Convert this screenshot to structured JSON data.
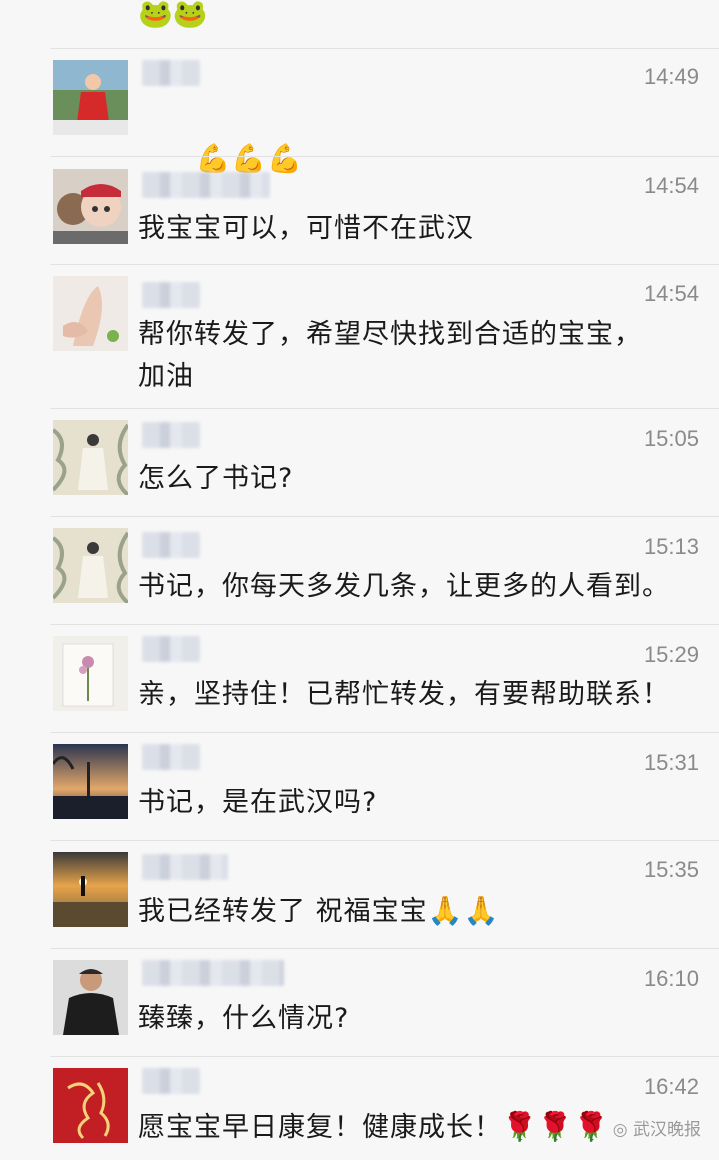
{
  "top_row": {
    "emojis": "🐸🐸"
  },
  "comments": [
    {
      "time": "14:49",
      "message": "",
      "emojis": "💪💪💪",
      "avatar": "avatar-girl-red-dress"
    },
    {
      "time": "14:54",
      "message": "我宝宝可以，可惜不在武汉",
      "emojis": "",
      "avatar": "avatar-baby-headband"
    },
    {
      "time": "14:54",
      "message": "帮你转发了，希望尽快找到合适的宝宝，\n加油",
      "emojis": "",
      "avatar": "avatar-baby-feet"
    },
    {
      "time": "15:05",
      "message": "怎么了书记?",
      "emojis": "",
      "avatar": "avatar-woman-floral"
    },
    {
      "time": "15:13",
      "message": "书记，你每天多发几条，让更多的人看到。",
      "emojis": "",
      "avatar": "avatar-woman-floral"
    },
    {
      "time": "15:29",
      "message": "亲，坚持住！已帮忙转发，有要帮助联系！",
      "emojis": "",
      "avatar": "avatar-flower-painting"
    },
    {
      "time": "15:31",
      "message": "书记，是在武汉吗?",
      "emojis": "",
      "avatar": "avatar-sunset-tower"
    },
    {
      "time": "15:35",
      "message": "我已经转发了 祝福宝宝",
      "emojis": "🙏🙏",
      "avatar": "avatar-beach-silhouette"
    },
    {
      "time": "16:10",
      "message": "臻臻，什么情况?",
      "emojis": "",
      "avatar": "avatar-man-black"
    },
    {
      "time": "16:42",
      "message": "愿宝宝早日康复！健康成长！",
      "emojis": "🌹🌹🌹",
      "avatar": "avatar-red-calligraphy"
    }
  ],
  "watermark": {
    "icon": "wechat-icon",
    "text": "武汉晚报"
  }
}
